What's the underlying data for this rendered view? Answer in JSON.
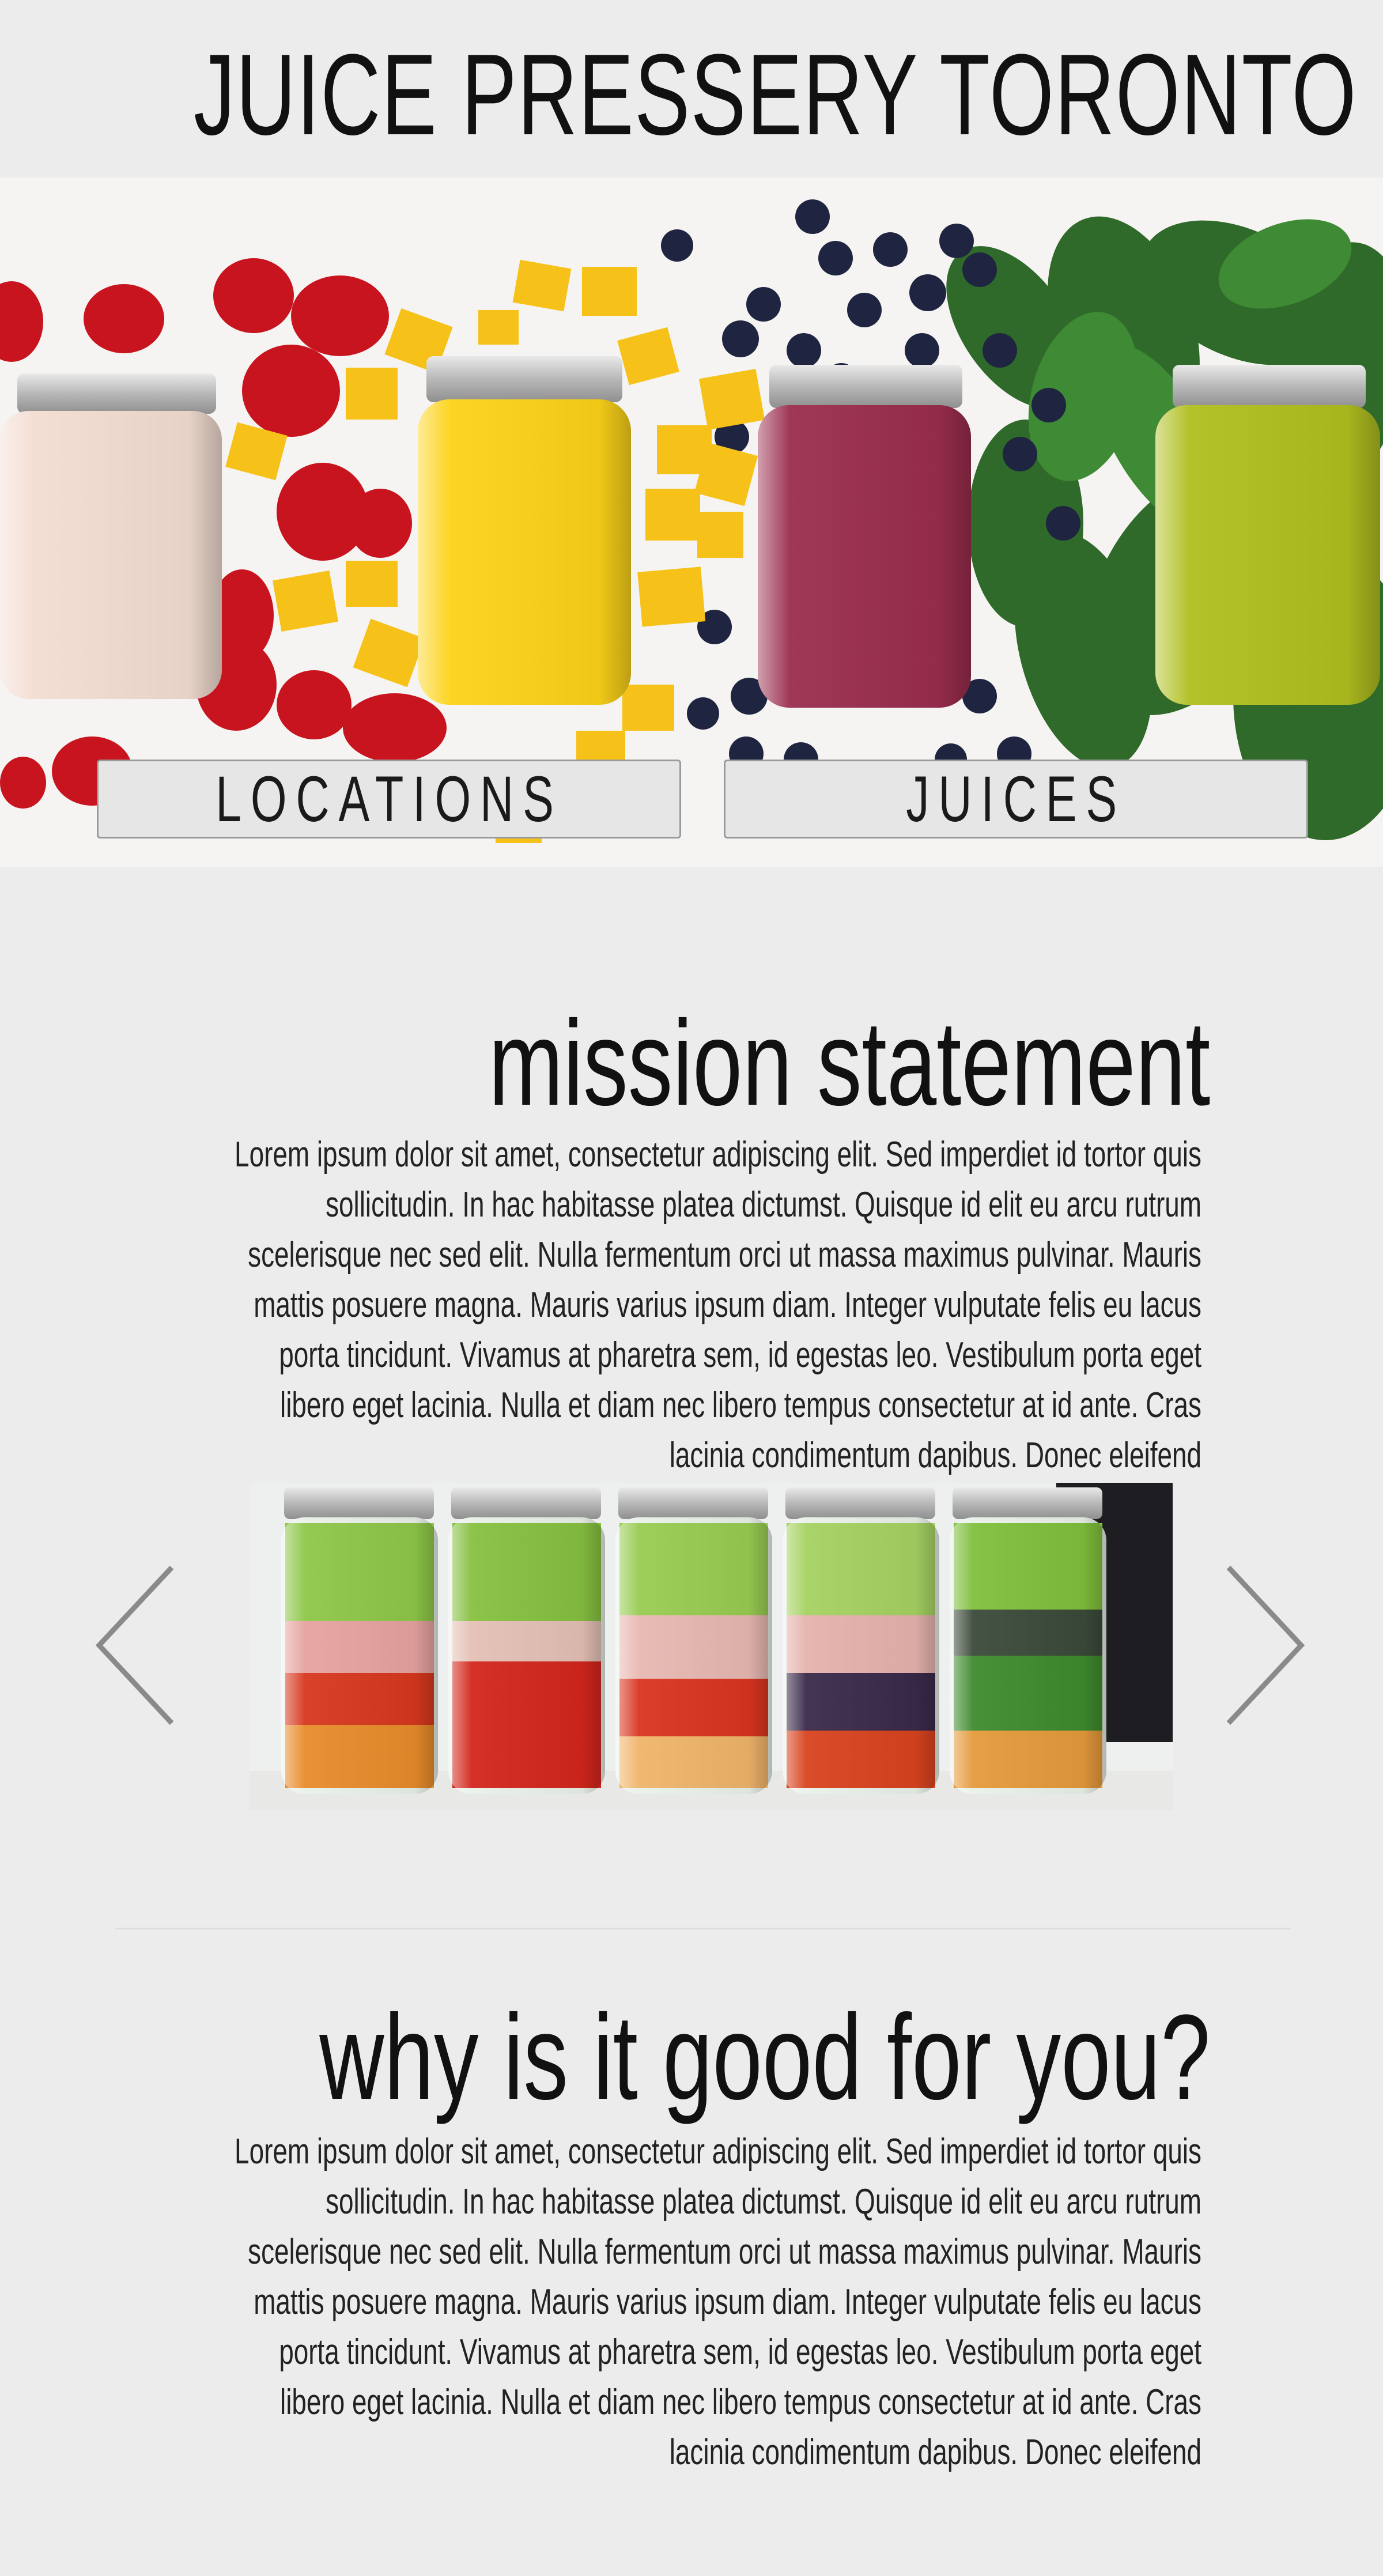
{
  "site": {
    "title": "JUICE PRESSERY TORONTO"
  },
  "nav": {
    "locations_label": "LOCATIONS",
    "juices_label": "JUICES"
  },
  "mission": {
    "heading": "mission statement",
    "body": "Lorem ipsum dolor sit amet, consectetur adipiscing elit. Sed imperdiet id tortor quis sollicitudin. In hac habitasse platea dictumst. Quisque id elit eu arcu rutrum scelerisque nec sed elit. Nulla fermentum orci ut massa maximus pulvinar. Mauris mattis posuere magna. Mauris varius ipsum diam. Integer vulputate felis eu lacus porta tincidunt. Vivamus at pharetra sem, id egestas leo. Vestibulum porta eget libero eget lacinia. Nulla et diam nec libero tempus consectetur at id ante. Cras lacinia condimentum dapibus. Donec eleifend"
  },
  "carousel": {
    "prev_icon": "chevron-left-icon",
    "next_icon": "chevron-right-icon"
  },
  "why": {
    "heading": "why is it good for you?",
    "body": "Lorem ipsum dolor sit amet, consectetur adipiscing elit. Sed imperdiet id tortor quis sollicitudin. In hac habitasse platea dictumst. Quisque id elit eu arcu rutrum scelerisque nec sed elit. Nulla fermentum orci ut massa maximus pulvinar. Mauris mattis posuere magna. Mauris varius ipsum diam. Integer vulputate felis eu lacus porta tincidunt. Vivamus at pharetra sem, id egestas leo. Vestibulum porta eget libero eget lacinia. Nulla et diam nec libero tempus consectetur at id ante. Cras lacinia condimentum dapibus. Donec eleifend"
  },
  "colors": {
    "background": "#ececec",
    "text": "#111111",
    "button_fill": "#e6e6e6",
    "arrow": "#8a8a8a"
  }
}
